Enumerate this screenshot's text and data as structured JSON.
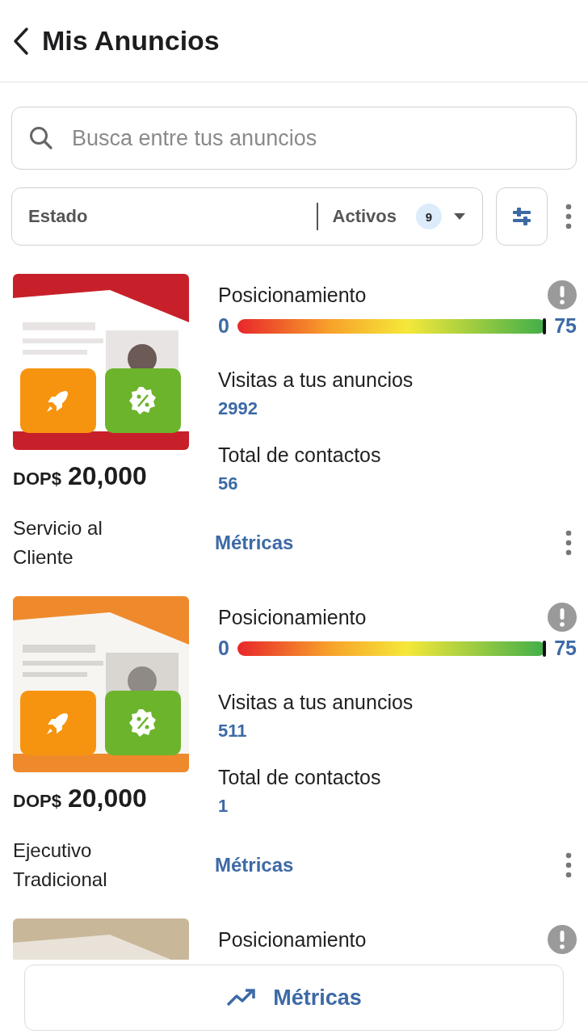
{
  "header": {
    "title": "Mis Anuncios"
  },
  "search": {
    "placeholder": "Busca entre tus anuncios"
  },
  "filter": {
    "label": "Estado",
    "value": "Activos",
    "count": "9"
  },
  "listings": [
    {
      "kind": "picture",
      "currency": "DOP$",
      "price": "20,000",
      "title": "Servicio al Cliente",
      "positioning_label": "Posicionamiento",
      "min": "0",
      "max": "75",
      "level": 1,
      "visits_label": "Visitas a tus anuncios",
      "visits": "2992",
      "contacts_label": "Total de contactos",
      "contacts": "56",
      "metrics_link": "Métricas"
    },
    {
      "kind": "picture",
      "currency": "DOP$",
      "price": "20,000",
      "title": "Ejecutivo Tradicional",
      "positioning_label": "Posicionamiento",
      "min": "0",
      "max": "75",
      "level": 1,
      "visits_label": "Visitas a tus anuncios",
      "visits": "511",
      "contacts_label": "Total de contactos",
      "contacts": "1",
      "metrics_link": "Métricas"
    },
    {
      "kind": "picture",
      "positioning_label": "Posicionamiento"
    }
  ],
  "bottom_button": {
    "label": "Métricas"
  }
}
